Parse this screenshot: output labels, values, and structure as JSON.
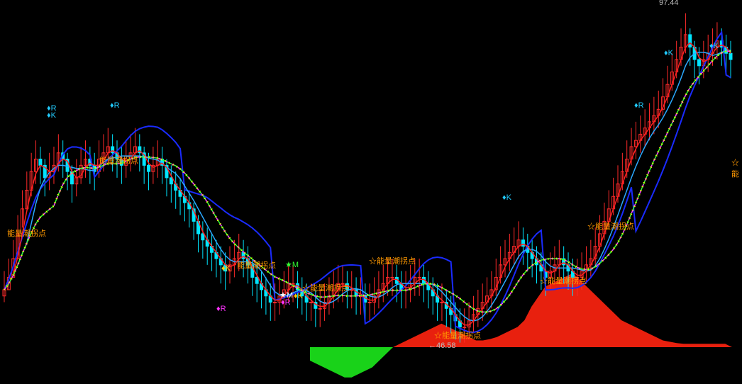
{
  "chart_data": {
    "type": "candlestick",
    "background": "#000000",
    "y_range": [
      44,
      99
    ],
    "colors": {
      "up": "#ff2a2a",
      "down": "#00e5ff",
      "white_ma": "#ffffff",
      "red_ma": "#ff2020",
      "sky_ma": "#2aa8ff",
      "green_ma": "#33ff33",
      "magenta_ma": "#ff33ff",
      "yellow_dots": "#ffff00",
      "band": "#1a2bff",
      "area_pos": "#e8200e",
      "area_neg": "#19d219",
      "label_orange": "#ff9900",
      "label_cyan": "#22ccff",
      "label_magenta": "#ff33ff"
    },
    "closes": [
      53,
      55,
      58,
      62,
      66,
      69,
      72,
      74,
      73,
      71,
      72,
      73,
      75,
      74,
      72,
      70,
      71,
      73,
      74,
      73,
      72,
      74,
      75,
      76,
      75,
      74,
      73,
      74,
      75,
      76,
      75,
      73,
      72,
      73,
      74,
      73,
      71,
      70,
      69,
      68,
      67,
      66,
      64,
      62,
      61,
      60,
      59,
      58,
      57,
      56,
      57,
      58,
      59,
      58,
      57,
      55,
      54,
      53,
      52,
      51,
      51,
      52,
      53,
      54,
      54,
      53,
      52,
      51,
      51,
      50,
      50,
      51,
      52,
      53,
      54,
      54,
      53,
      53,
      52,
      52,
      51,
      51,
      52,
      53,
      54,
      55,
      55,
      54,
      53,
      53,
      54,
      55,
      55,
      54,
      53,
      52,
      51,
      51,
      50,
      49,
      48,
      47,
      47,
      48,
      49,
      50,
      51,
      52,
      53,
      55,
      57,
      58,
      59,
      60,
      61,
      60,
      59,
      58,
      57,
      56,
      55,
      56,
      57,
      58,
      57,
      56,
      55,
      55,
      56,
      57,
      58,
      60,
      62,
      64,
      66,
      68,
      70,
      72,
      74,
      76,
      77,
      78,
      79,
      80,
      81,
      82,
      84,
      86,
      88,
      90,
      92,
      94,
      92,
      90,
      89,
      90,
      91,
      92,
      93,
      92,
      91,
      90
    ],
    "lows": [
      51,
      53,
      55,
      59,
      63,
      66,
      68,
      70,
      70,
      68,
      69,
      70,
      72,
      71,
      69,
      67,
      68,
      70,
      71,
      70,
      69,
      71,
      72,
      73,
      72,
      71,
      70,
      71,
      72,
      73,
      72,
      70,
      69,
      70,
      71,
      70,
      68,
      67,
      66,
      65,
      64,
      63,
      61,
      59,
      58,
      57,
      56,
      55,
      54,
      53,
      54,
      55,
      56,
      55,
      54,
      52,
      51,
      50,
      49,
      48,
      48,
      49,
      50,
      51,
      51,
      50,
      49,
      48,
      48,
      47,
      47,
      48,
      49,
      50,
      51,
      51,
      50,
      50,
      49,
      49,
      48,
      48,
      49,
      50,
      51,
      52,
      52,
      51,
      50,
      50,
      51,
      52,
      52,
      51,
      50,
      49,
      48,
      48,
      47,
      46,
      45,
      44.5,
      44.5,
      45,
      46,
      47,
      48,
      49,
      50,
      52,
      54,
      55,
      56,
      57,
      58,
      57,
      56,
      55,
      54,
      53,
      52,
      53,
      54,
      55,
      54,
      53,
      52,
      52,
      53,
      54,
      55,
      57,
      59,
      61,
      63,
      65,
      67,
      69,
      71,
      73,
      74,
      75,
      76,
      77,
      78,
      79,
      81,
      83,
      85,
      87,
      89,
      91,
      89,
      87,
      86,
      87,
      88,
      89,
      90,
      89,
      88,
      87
    ],
    "highs": [
      56,
      58,
      61,
      65,
      69,
      72,
      75,
      77,
      76,
      74,
      75,
      76,
      78,
      77,
      75,
      73,
      74,
      76,
      77,
      76,
      75,
      77,
      78,
      79,
      78,
      77,
      76,
      77,
      78,
      79,
      78,
      76,
      75,
      76,
      77,
      76,
      74,
      73,
      72,
      71,
      70,
      69,
      67,
      65,
      64,
      63,
      62,
      61,
      60,
      59,
      60,
      61,
      62,
      61,
      60,
      58,
      57,
      56,
      55,
      54,
      54,
      55,
      56,
      57,
      57,
      56,
      55,
      54,
      54,
      53,
      53,
      54,
      55,
      56,
      57,
      57,
      56,
      56,
      55,
      55,
      54,
      54,
      55,
      56,
      57,
      58,
      58,
      57,
      56,
      56,
      57,
      58,
      58,
      57,
      56,
      55,
      54,
      54,
      53,
      52,
      51,
      50,
      50,
      51,
      52,
      53,
      54,
      55,
      56,
      58,
      60,
      61,
      62,
      63,
      64,
      63,
      62,
      61,
      60,
      59,
      58,
      59,
      60,
      61,
      60,
      59,
      58,
      58,
      59,
      60,
      61,
      63,
      65,
      67,
      69,
      71,
      73,
      75,
      77,
      79,
      80,
      81,
      82,
      83,
      84,
      85,
      87,
      89,
      91,
      93,
      95,
      97.44,
      95,
      93,
      92,
      93,
      94,
      95,
      96,
      95,
      94,
      93
    ],
    "oscillator": [
      -20,
      -25,
      -30,
      -35,
      -40,
      -45,
      -45,
      -40,
      -35,
      -30,
      -20,
      -10,
      0,
      5,
      10,
      15,
      20,
      25,
      30,
      35,
      30,
      25,
      20,
      15,
      10,
      10,
      12,
      15,
      20,
      25,
      30,
      40,
      60,
      75,
      90,
      95,
      100,
      105,
      110,
      100,
      90,
      80,
      70,
      60,
      50,
      40,
      35,
      30,
      25,
      20,
      15,
      10,
      8,
      6,
      5,
      5,
      5,
      5,
      5,
      5,
      5,
      0
    ],
    "labels": {
      "price_high": "97.44",
      "price_low": "46.58",
      "energy": "能量潮拐点",
      "energy_star": "☆能量潮拐点",
      "R": "♦R",
      "K": "♦K",
      "KM": "★M",
      "M": "★M",
      "K2": "♦K",
      "energy_trunc_left": "能量潮拐点",
      "energy_trunc_right": "☆能"
    }
  }
}
